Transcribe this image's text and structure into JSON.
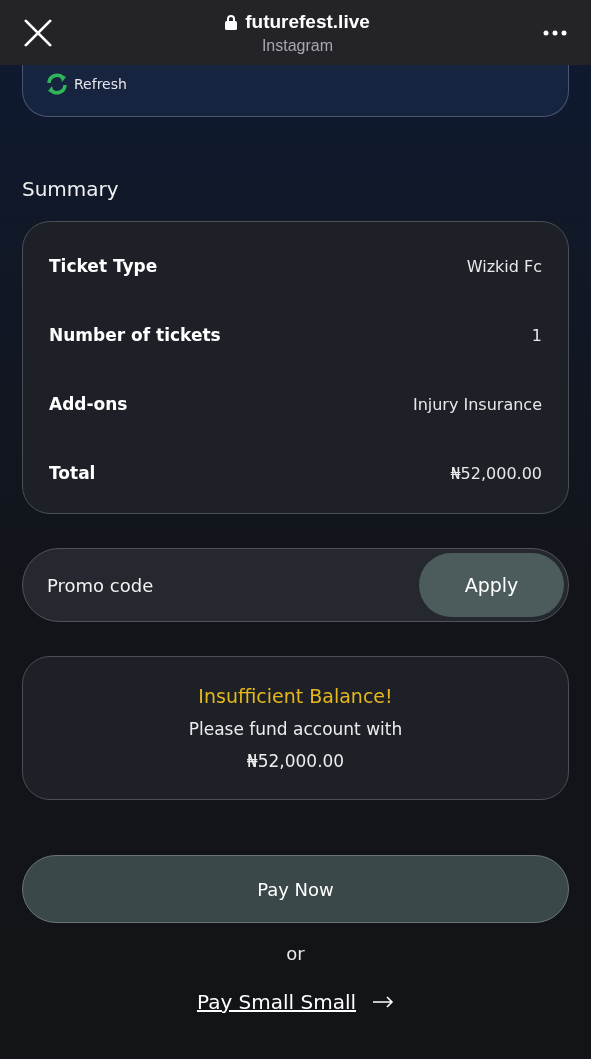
{
  "browser_bar": {
    "domain": "futurefest.live",
    "source": "Instagram"
  },
  "refresh": {
    "label": "Refresh"
  },
  "summary": {
    "title": "Summary",
    "rows": [
      {
        "label": "Ticket Type",
        "value": "Wizkid Fc"
      },
      {
        "label": "Number of tickets",
        "value": "1"
      },
      {
        "label": "Add-ons",
        "value": "Injury Insurance"
      },
      {
        "label": "Total",
        "value": "₦52,000.00"
      }
    ]
  },
  "promo": {
    "placeholder": "Promo code",
    "button": "Apply"
  },
  "balance_alert": {
    "title": "Insufficient Balance!",
    "message": "Please fund account with",
    "amount": "₦52,000.00"
  },
  "pay_button": "Pay Now",
  "separator": "or",
  "alt_link": "Pay Small Small"
}
